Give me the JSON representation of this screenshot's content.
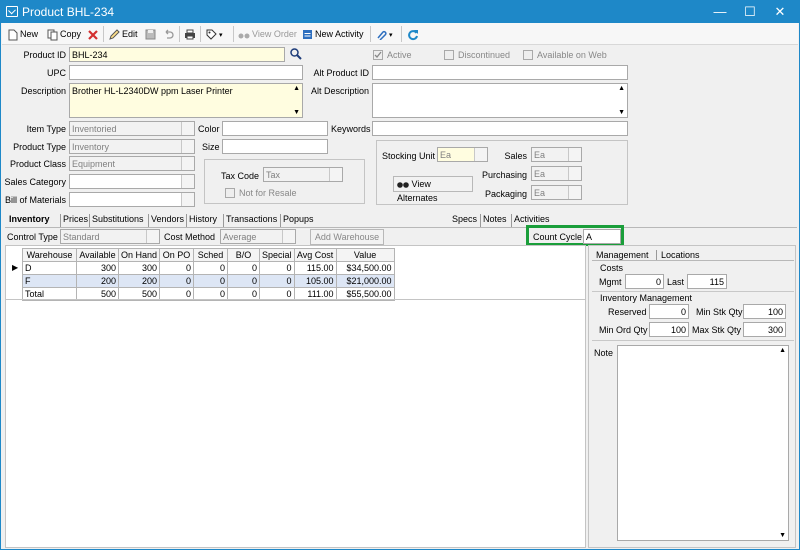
{
  "window": {
    "title": "Product BHL-234",
    "minimize": "—",
    "maximize": "☐",
    "close": "✕"
  },
  "toolbar": {
    "new": "New",
    "copy": "Copy",
    "edit": "Edit",
    "view_order": "View Order",
    "new_activity": "New Activity"
  },
  "product": {
    "product_id_label": "Product ID",
    "product_id": "BHL-234",
    "upc_label": "UPC",
    "upc": "",
    "description_label": "Description",
    "description": "Brother HL-L2340DW ppm Laser Printer",
    "alt_product_id_label": "Alt Product ID",
    "alt_product_id": "",
    "alt_description_label": "Alt Description",
    "alt_description": "",
    "active_label": "Active",
    "discontinued_label": "Discontinued",
    "available_web_label": "Available on Web",
    "item_type_label": "Item Type",
    "item_type": "Inventoried",
    "product_type_label": "Product Type",
    "product_type": "Inventory",
    "product_class_label": "Product Class",
    "product_class": "Equipment",
    "sales_category_label": "Sales Category",
    "sales_category": "",
    "bom_label": "Bill of Materials",
    "bom": "",
    "color_label": "Color",
    "color": "",
    "size_label": "Size",
    "size": "",
    "keywords_label": "Keywords",
    "keywords": "",
    "tax_code_label": "Tax Code",
    "tax_code": "Tax",
    "not_for_resale_label": "Not for Resale",
    "stocking_unit_label": "Stocking Unit",
    "stocking_unit": "Ea",
    "sales_label": "Sales",
    "sales_unit": "Ea",
    "purchasing_label": "Purchasing",
    "purchasing_unit": "Ea",
    "packaging_label": "Packaging",
    "packaging_unit": "Ea",
    "view_alternates": "View Alternates"
  },
  "tabs": [
    "Inventory",
    "Prices",
    "Substitutions",
    "Vendors",
    "History",
    "Transactions",
    "Popups"
  ],
  "tabs_right": [
    "Specs",
    "Notes",
    "Activities"
  ],
  "inventory": {
    "control_type_label": "Control Type",
    "control_type": "Standard",
    "cost_method_label": "Cost Method",
    "cost_method": "Average",
    "add_warehouse": "Add Warehouse",
    "count_cycle_label": "Count Cycle",
    "count_cycle": "A",
    "columns": [
      "Warehouse",
      "Available",
      "On Hand",
      "On PO",
      "Sched",
      "B/O",
      "Special",
      "Avg Cost",
      "Value"
    ],
    "rows": [
      [
        "D",
        "300",
        "300",
        "0",
        "0",
        "0",
        "0",
        "115.00",
        "$34,500.00"
      ],
      [
        "F",
        "200",
        "200",
        "0",
        "0",
        "0",
        "0",
        "105.00",
        "$21,000.00"
      ],
      [
        "Total",
        "500",
        "500",
        "0",
        "0",
        "0",
        "0",
        "111.00",
        "$55,500.00"
      ]
    ]
  },
  "management": {
    "tabs": [
      "Management",
      "Locations"
    ],
    "costs_label": "Costs",
    "mgmt_label": "Mgmt",
    "mgmt": "0",
    "last_label": "Last",
    "last": "115",
    "inv_mgmt_label": "Inventory Management",
    "reserved_label": "Reserved",
    "reserved": "0",
    "min_stk_label": "Min Stk Qty",
    "min_stk": "100",
    "min_ord_label": "Min Ord Qty",
    "min_ord": "100",
    "max_stk_label": "Max Stk Qty",
    "max_stk": "300",
    "note_label": "Note",
    "note": ""
  },
  "colors": {
    "title_bar": "#1e88c8",
    "highlight_box": "#1a9e3a",
    "selected_row": "#dde6f5"
  }
}
